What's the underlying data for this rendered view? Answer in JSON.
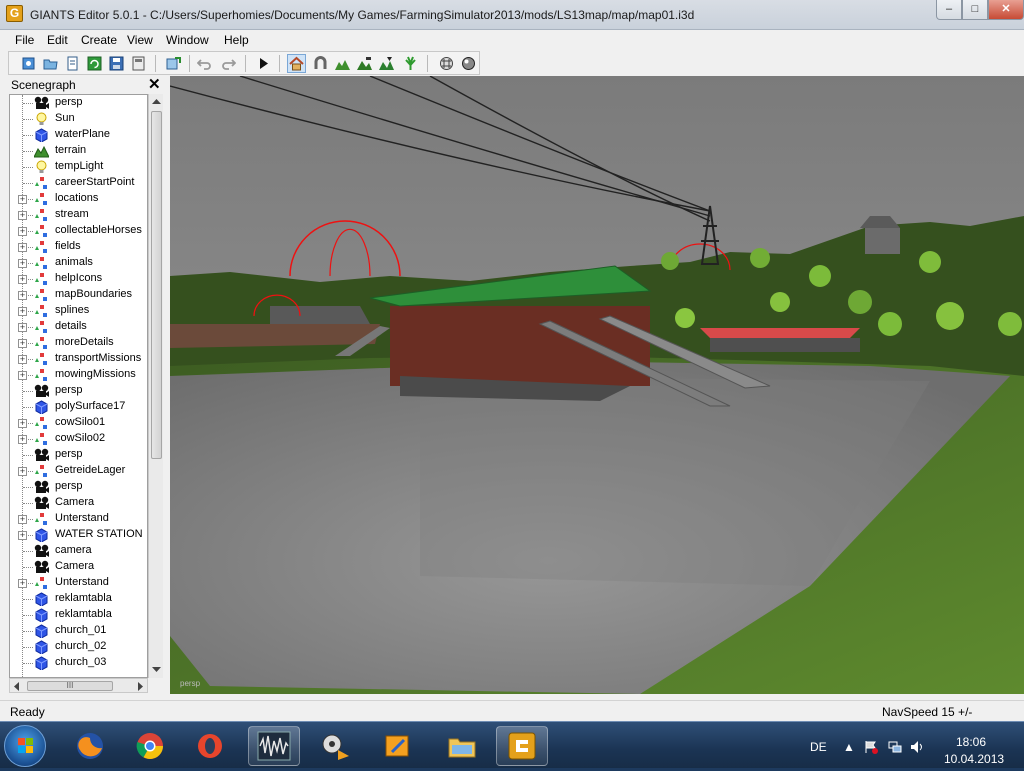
{
  "app": {
    "title": "GIANTS Editor 5.0.1 - C:/Users/Superhomies/Documents/My Games/FarmingSimulator2013/mods/LS13map/map/map01.i3d",
    "icon_letter": "G",
    "window_buttons": {
      "minimize": "–",
      "maximize": "□",
      "close": "✕"
    }
  },
  "menu": [
    "File",
    "Edit",
    "Create",
    "View",
    "Window",
    "Help"
  ],
  "toolbar": {
    "icons": [
      "new-file-icon",
      "open-file-icon",
      "document-icon",
      "refresh-icon",
      "save-icon",
      "save-as-icon",
      "import-icon",
      "undo-icon",
      "redo-icon",
      "play-icon",
      "home-view-icon",
      "magnet-icon",
      "terrain-sculpt-icon",
      "terrain-paint-icon",
      "foliage-paint-icon",
      "plant-paint-icon",
      "render-settings-icon",
      "shader-icon"
    ]
  },
  "scenegraph": {
    "title": "Scenegraph",
    "close_label": "✕",
    "nodes": [
      {
        "label": "persp",
        "icon": "camera-icon",
        "expand": false
      },
      {
        "label": "Sun",
        "icon": "light-icon",
        "expand": false
      },
      {
        "label": "waterPlane",
        "icon": "shape-icon",
        "expand": false
      },
      {
        "label": "terrain",
        "icon": "terrain-icon",
        "expand": false
      },
      {
        "label": "tempLight",
        "icon": "light-icon",
        "expand": false
      },
      {
        "label": "careerStartPoint",
        "icon": "transform-icon",
        "expand": false
      },
      {
        "label": "locations",
        "icon": "transform-icon",
        "expand": true
      },
      {
        "label": "stream",
        "icon": "transform-icon",
        "expand": true
      },
      {
        "label": "collectableHorses",
        "icon": "transform-icon",
        "expand": true
      },
      {
        "label": "fields",
        "icon": "transform-icon",
        "expand": true
      },
      {
        "label": "animals",
        "icon": "transform-icon",
        "expand": true
      },
      {
        "label": "helpIcons",
        "icon": "transform-icon",
        "expand": true
      },
      {
        "label": "mapBoundaries",
        "icon": "transform-icon",
        "expand": true
      },
      {
        "label": "splines",
        "icon": "transform-icon",
        "expand": true
      },
      {
        "label": "details",
        "icon": "transform-icon",
        "expand": true
      },
      {
        "label": "moreDetails",
        "icon": "transform-icon",
        "expand": true
      },
      {
        "label": "transportMissions",
        "icon": "transform-icon",
        "expand": true
      },
      {
        "label": "mowingMissions",
        "icon": "transform-icon",
        "expand": true
      },
      {
        "label": "persp",
        "icon": "camera-icon",
        "expand": false
      },
      {
        "label": "polySurface17",
        "icon": "shape-icon",
        "expand": false
      },
      {
        "label": "cowSilo01",
        "icon": "transform-icon",
        "expand": true
      },
      {
        "label": "cowSilo02",
        "icon": "transform-icon",
        "expand": true
      },
      {
        "label": "persp",
        "icon": "camera-icon",
        "expand": false
      },
      {
        "label": "GetreideLager",
        "icon": "transform-icon",
        "expand": true
      },
      {
        "label": "persp",
        "icon": "camera-icon",
        "expand": false
      },
      {
        "label": "Camera",
        "icon": "camera-icon",
        "expand": false
      },
      {
        "label": "Unterstand",
        "icon": "transform-icon",
        "expand": true
      },
      {
        "label": "WATER STATION",
        "icon": "shape-icon",
        "expand": true
      },
      {
        "label": "camera",
        "icon": "camera-icon",
        "expand": false
      },
      {
        "label": "Camera",
        "icon": "camera-icon",
        "expand": false
      },
      {
        "label": "Unterstand",
        "icon": "transform-icon",
        "expand": true
      },
      {
        "label": "reklamtabla",
        "icon": "shape-icon",
        "expand": false
      },
      {
        "label": "reklamtabla",
        "icon": "shape-icon",
        "expand": false
      },
      {
        "label": "church_01",
        "icon": "shape-icon",
        "expand": false
      },
      {
        "label": "church_02",
        "icon": "shape-icon",
        "expand": false
      },
      {
        "label": "church_03",
        "icon": "shape-icon",
        "expand": false
      }
    ],
    "hscroll_grip": "III"
  },
  "viewport": {
    "camera_label": "persp",
    "colors": {
      "sky": "#8a8a8a",
      "grass": "#4f7a2a",
      "concrete": "#8f8f8f",
      "roof": "#2d8a36",
      "red_roof": "#d84a4a"
    }
  },
  "status": {
    "left": "Ready",
    "right": "NavSpeed 15 +/-"
  },
  "taskbar": {
    "apps": [
      "firefox-icon",
      "chrome-icon",
      "opera-icon",
      "audio-editor-icon",
      "media-player-icon",
      "video-editor-icon",
      "file-explorer-icon",
      "giants-editor-icon"
    ],
    "lang": "DE",
    "time": "18:06",
    "date": "10.04.2013"
  }
}
